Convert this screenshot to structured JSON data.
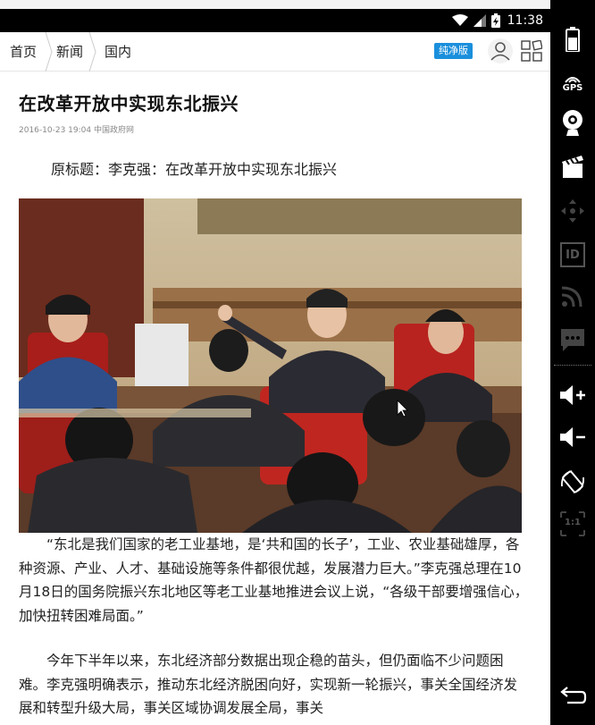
{
  "status_bar": {
    "time": "11:38"
  },
  "nav": {
    "crumbs": [
      "首页",
      "新闻",
      "国内"
    ],
    "badge": "纯净版"
  },
  "article": {
    "title": "在改革开放中实现东北振兴",
    "date": "2016-10-23 19:04",
    "source": "中国政府网",
    "original_title": "原标题：李克强：在改革开放中实现东北振兴",
    "paragraphs": [
      "“东北是我们国家的老工业基地，是‘共和国的长子’，工业、农业基础雄厚，各种资源、产业、人才、基础设施等条件都很优越，发展潜力巨大。”李克强总理在10月18日的国务院振兴东北地区等老工业基地推进会议上说，“各级干部要增强信心，加快扭转困难局面。”",
      "今年下半年以来，东北经济部分数据出现企稳的苗头，但仍面临不少问题困难。李克强明确表示，推动东北经济脱困向好，实现新一轮振兴，事关全国经济发展和转型升级大局，事关区域协调发展全局，事关"
    ]
  },
  "sidebar": {
    "gps_label": "GPS",
    "id_label": "ID",
    "scale_label": "1:1"
  },
  "colors": {
    "badge_blue": "#1a8fdc",
    "status_bar": "#000000",
    "text": "#222222"
  }
}
